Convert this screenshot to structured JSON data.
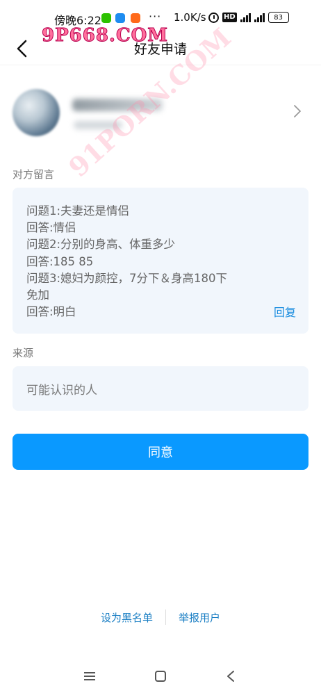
{
  "status_bar": {
    "time": "傍晚6:22",
    "more": "···",
    "speed": "1.0K/s",
    "hd": "HD",
    "signal1": "4G",
    "signal2": "4G",
    "battery": "83"
  },
  "watermark": {
    "top": "9P668.COM",
    "diagonal": "91PORN.COM"
  },
  "header": {
    "title": "好友申请"
  },
  "message": {
    "label": "对方留言",
    "lines": [
      "问题1:夫妻还是情侣",
      "回答:情侣",
      "问题2:分别的身高、体重多少",
      "回答:185  85",
      "问题3:媳妇为颜控，7分下＆身高180下",
      "免加",
      "回答:明白"
    ],
    "reply_label": "回复"
  },
  "source": {
    "label": "来源",
    "value": "可能认识的人"
  },
  "agree_button": "同意",
  "bottom_links": {
    "blacklist": "设为黑名单",
    "report": "举报用户"
  },
  "colors": {
    "accent": "#0a99ff",
    "link": "#1b8ddf",
    "card_bg": "#f1f6fc"
  }
}
